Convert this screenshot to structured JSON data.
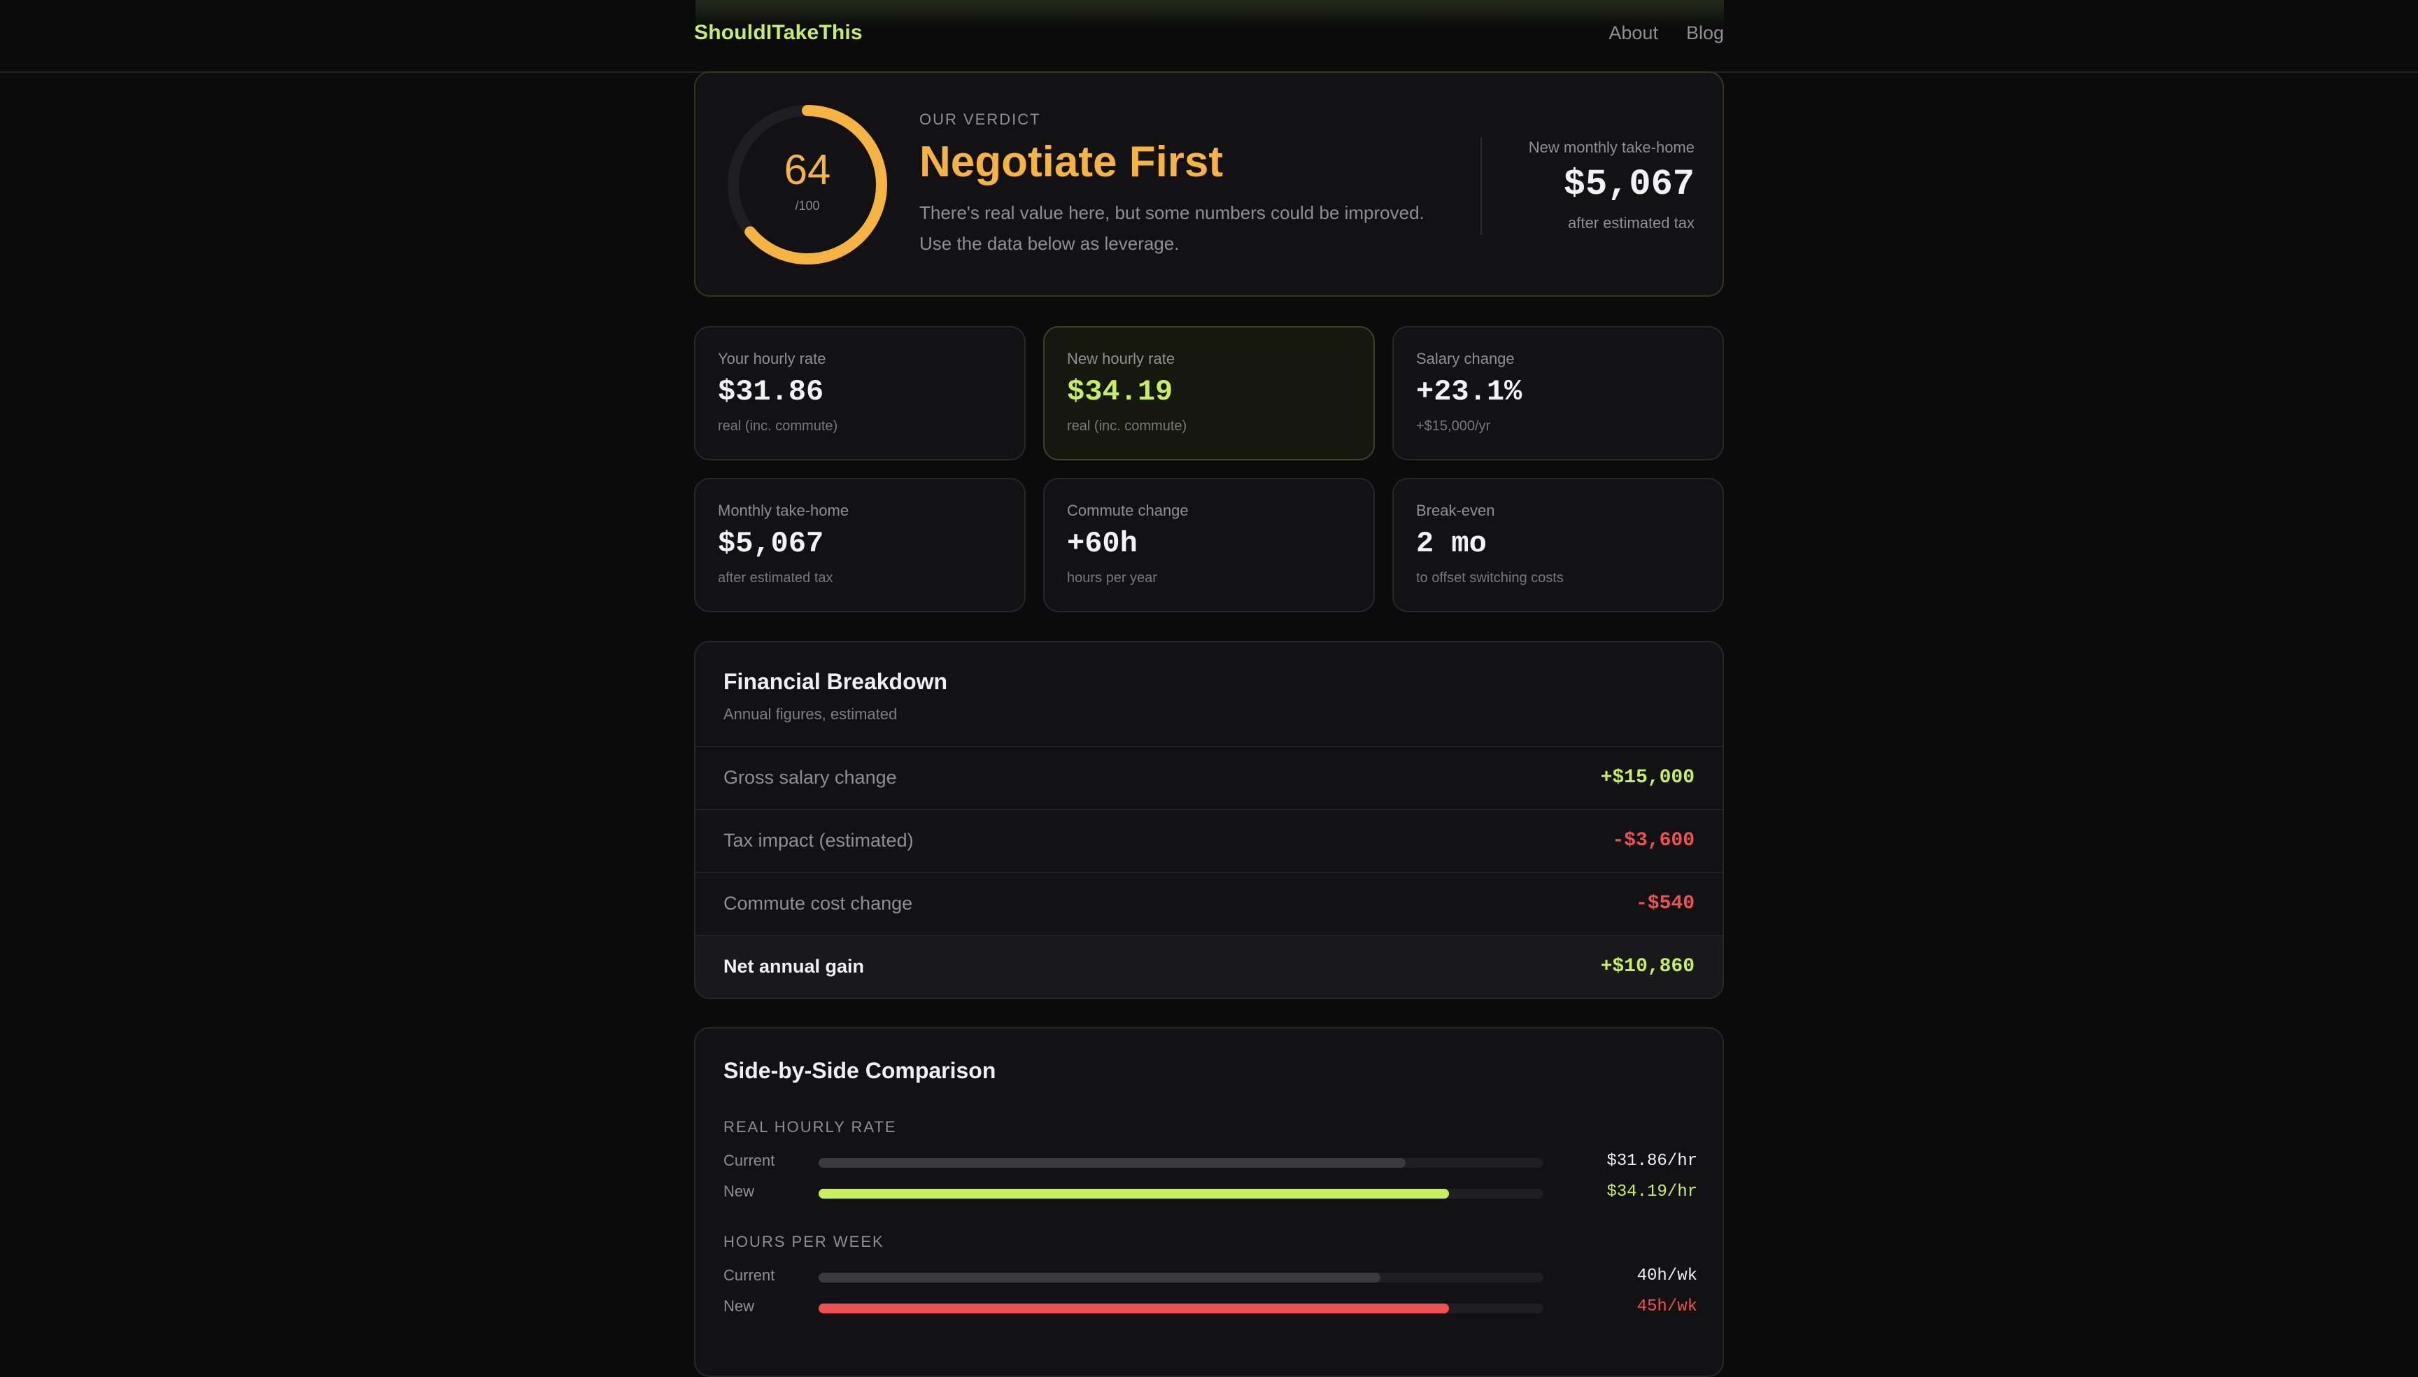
{
  "nav": {
    "logo": "ShouldITakeThis",
    "links": [
      "About",
      "Blog"
    ]
  },
  "verdict": {
    "score": "64",
    "score_value": 64,
    "score_max_label": "/100",
    "label": "OUR VERDICT",
    "title": "Negotiate First",
    "description": "There's real value here, but some numbers could be improved. Use the data below as leverage.",
    "take_home_label": "New monthly take-home",
    "take_home_value": "$5,067",
    "take_home_sub": "after estimated tax",
    "accent": "#f5b340"
  },
  "stats": [
    {
      "label": "Your hourly rate",
      "value": "$31.86",
      "sub": "real (inc. commute)"
    },
    {
      "label": "New hourly rate",
      "value": "$34.19",
      "sub": "real (inc. commute)"
    },
    {
      "label": "Salary change",
      "value": "+23.1%",
      "sub": "+$15,000/yr"
    },
    {
      "label": "Monthly take-home",
      "value": "$5,067",
      "sub": "after estimated tax"
    },
    {
      "label": "Commute change",
      "value": "+60h",
      "sub": "hours per year"
    },
    {
      "label": "Break-even",
      "value": "2 mo",
      "sub": "to offset switching costs"
    }
  ],
  "breakdown": {
    "title": "Financial Breakdown",
    "subtitle": "Annual figures, estimated",
    "rows": [
      {
        "label": "Gross salary change",
        "value": "+$15,000"
      },
      {
        "label": "Tax impact (estimated)",
        "value": "-$3,600"
      },
      {
        "label": "Commute cost change",
        "value": "-$540"
      },
      {
        "label": "Net annual gain",
        "value": "+$10,860"
      }
    ]
  },
  "comparison": {
    "title": "Side-by-Side Comparison",
    "groups": [
      {
        "name": "REAL HOURLY RATE",
        "rows": [
          {
            "label": "Current",
            "value": "$31.86/hr",
            "fill": 0.81,
            "color": "#3a3a3f"
          },
          {
            "label": "New",
            "value": "$34.19/hr",
            "fill": 0.87,
            "color": "#c8ee5c"
          }
        ]
      },
      {
        "name": "HOURS PER WEEK",
        "rows": [
          {
            "label": "Current",
            "value": "40h/wk",
            "fill": 0.775,
            "color": "#3a3a3f"
          },
          {
            "label": "New",
            "value": "45h/wk",
            "fill": 0.87,
            "color": "#ef5150"
          }
        ]
      }
    ]
  },
  "colors": {
    "green": "#c8ee5c",
    "red": "#ef5150",
    "amber": "#f5b340"
  }
}
